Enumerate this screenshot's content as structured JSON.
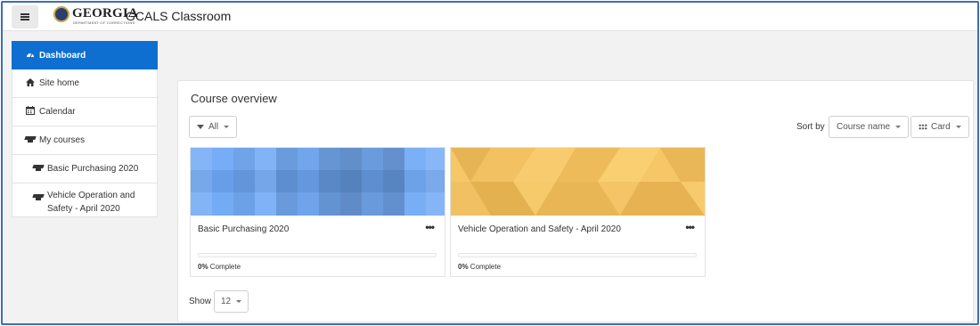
{
  "navbar": {
    "menu_icon": "hamburger-icon",
    "logo_text": "GEORGIA",
    "logo_subtext": "DEPARTMENT OF CORRECTIONS",
    "site_name": "GCALS Classroom"
  },
  "sidebar": {
    "items": [
      {
        "label": "Dashboard",
        "icon": "dashboard-icon",
        "active": true
      },
      {
        "label": "Site home",
        "icon": "home-icon"
      },
      {
        "label": "Calendar",
        "icon": "calendar-icon"
      },
      {
        "label": "My courses",
        "icon": "graduation-cap-icon"
      },
      {
        "label": "Basic Purchasing 2020",
        "icon": "graduation-cap-icon"
      },
      {
        "label": "Vehicle Operation and Safety - April 2020",
        "icon": "graduation-cap-icon"
      }
    ]
  },
  "overview": {
    "title": "Course overview",
    "filter_label": "All",
    "sort_by_label": "Sort by",
    "sort_value": "Course name",
    "view_label": "Card",
    "show_label": "Show",
    "show_value": "12"
  },
  "courses": [
    {
      "name": "Basic Purchasing 2020",
      "progress_percent": 0,
      "progress_value": "0%",
      "progress_suffix": " Complete",
      "image_color": "#6ea8f5"
    },
    {
      "name": "Vehicle Operation and Safety - April 2020",
      "progress_percent": 0,
      "progress_value": "0%",
      "progress_suffix": " Complete",
      "image_color": "#f6c766"
    }
  ],
  "colors": {
    "accent": "#0f6fd0",
    "frame_border": "#3b6fb6"
  }
}
